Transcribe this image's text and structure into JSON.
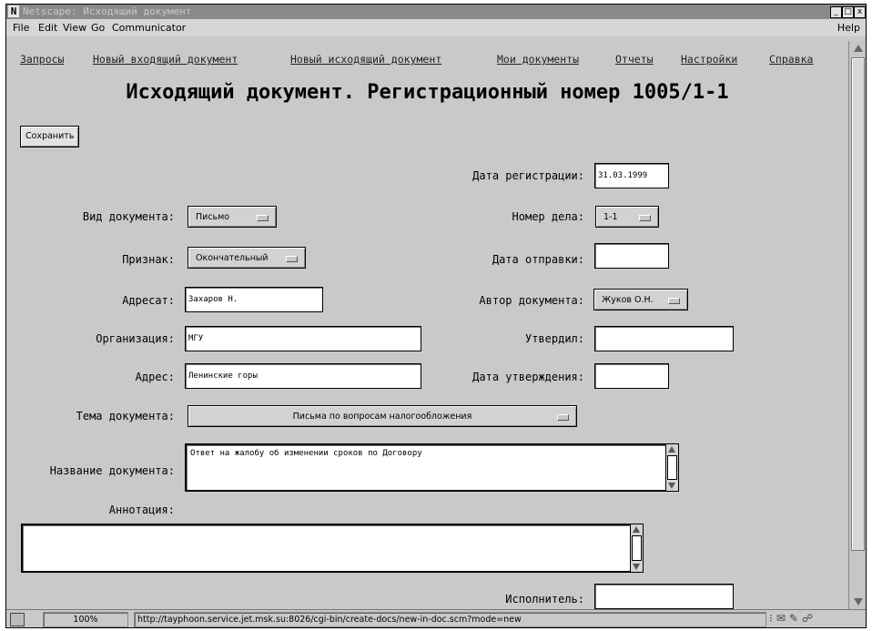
{
  "window": {
    "title": "Netscape: Исходящий документ",
    "logo": "N",
    "controls": [
      "_",
      "□",
      "x"
    ]
  },
  "menubar": {
    "items": [
      "File",
      "Edit",
      "View",
      "Go",
      "Communicator"
    ],
    "help": "Help"
  },
  "nav": [
    "Запросы",
    "Новый входящий документ",
    "Новый исходящий документ",
    "Мои документы",
    "Отчеты",
    "Настройки",
    "Справка"
  ],
  "page": {
    "title": "Исходящий документ. Регистрационный номер 1005/1-1",
    "save_button": "Сохранить"
  },
  "form": {
    "reg_date": {
      "label": "Дата регистрации:",
      "value": "31.03.1999"
    },
    "doc_type": {
      "label": "Вид документа:",
      "value": "Письмо"
    },
    "case_number": {
      "label": "Номер дела:",
      "value": "1-1"
    },
    "sign": {
      "label": "Признак:",
      "value": "Окончательный"
    },
    "send_date": {
      "label": "Дата отправки:",
      "value": ""
    },
    "addressee": {
      "label": "Адресат:",
      "value": "Захаров Н."
    },
    "author": {
      "label": "Автор документа:",
      "value": "Жуков О.Н."
    },
    "organization": {
      "label": "Организация:",
      "value": "МГУ"
    },
    "approved_by": {
      "label": "Утвердил:",
      "value": ""
    },
    "address": {
      "label": "Адрес:",
      "value": "Ленинские горы"
    },
    "approval_date": {
      "label": "Дата утверждения:",
      "value": ""
    },
    "topic": {
      "label": "Тема документа:",
      "value": "Письма по вопросам налогообложения"
    },
    "doc_name": {
      "label": "Название документа:",
      "value": "Ответ на жалобу об изменении сроков по Договору"
    },
    "annotation": {
      "label": "Аннотация:",
      "value": ""
    },
    "executor": {
      "label": "Исполнитель:",
      "value": ""
    }
  },
  "status": {
    "zoom": "100%",
    "url": "http://tayphoon.service.jet.msk.su:8026/cgi-bin/create-docs/new-in-doc.scm?mode=new",
    "tray_icons": [
      "network-icon",
      "mail-icon",
      "composer-icon",
      "component-icon"
    ]
  },
  "colors": {
    "window_bg": "#c9c9c9",
    "titlebar": "#8a8a8a",
    "field_bg": "#ffffff"
  }
}
